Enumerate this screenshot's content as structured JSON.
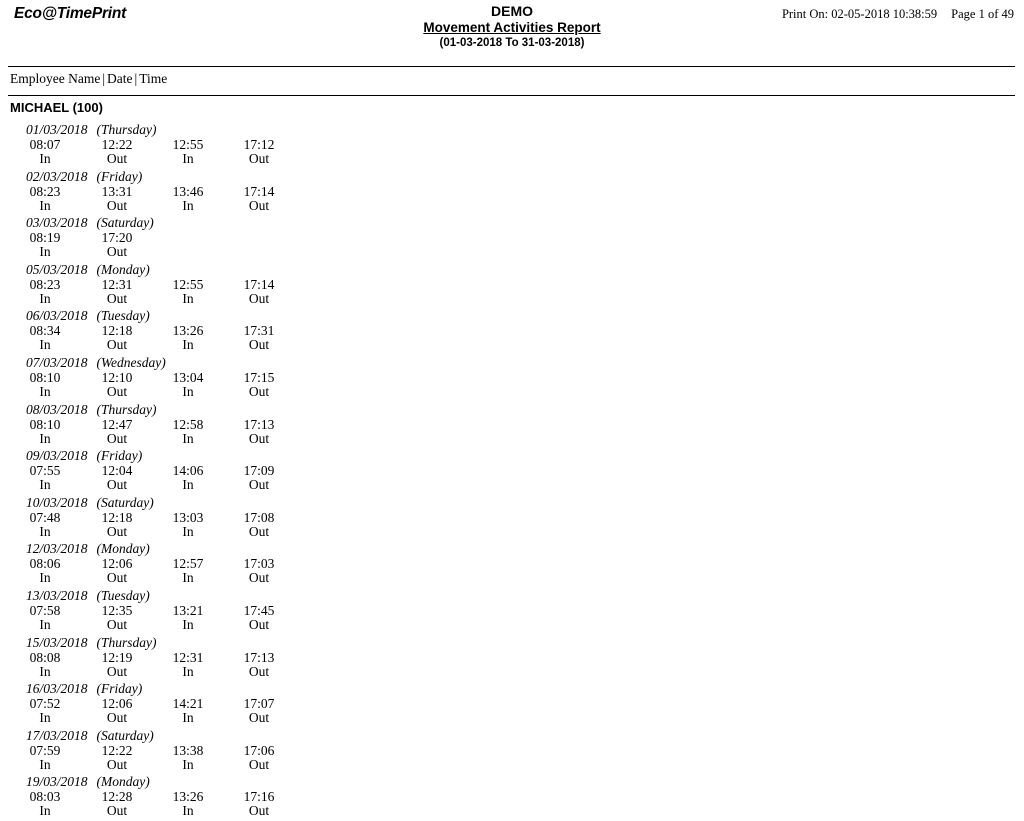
{
  "header": {
    "brand": "Eco@TimePrint",
    "company": "DEMO",
    "report_title": "Movement Activities Report",
    "date_range": "(01-03-2018 To 31-03-2018)",
    "print_on": "Print On: 02-05-2018 10:38:59",
    "page_indicator": "Page 1 of 49"
  },
  "columns": {
    "employee_name": "Employee Name",
    "separator": "|",
    "date": "Date",
    "time": "Time"
  },
  "employee": {
    "name": "MICHAEL (100)"
  },
  "days": [
    {
      "date": "01/03/2018",
      "day_of_week": "(Thursday)",
      "punches": [
        {
          "time": "08:07",
          "type": "In"
        },
        {
          "time": "12:22",
          "type": "Out"
        },
        {
          "time": "12:55",
          "type": "In"
        },
        {
          "time": "17:12",
          "type": "Out"
        }
      ]
    },
    {
      "date": "02/03/2018",
      "day_of_week": "(Friday)",
      "punches": [
        {
          "time": "08:23",
          "type": "In"
        },
        {
          "time": "13:31",
          "type": "Out"
        },
        {
          "time": "13:46",
          "type": "In"
        },
        {
          "time": "17:14",
          "type": "Out"
        }
      ]
    },
    {
      "date": "03/03/2018",
      "day_of_week": "(Saturday)",
      "punches": [
        {
          "time": "08:19",
          "type": "In"
        },
        {
          "time": "17:20",
          "type": "Out"
        }
      ]
    },
    {
      "date": "05/03/2018",
      "day_of_week": "(Monday)",
      "punches": [
        {
          "time": "08:23",
          "type": "In"
        },
        {
          "time": "12:31",
          "type": "Out"
        },
        {
          "time": "12:55",
          "type": "In"
        },
        {
          "time": "17:14",
          "type": "Out"
        }
      ]
    },
    {
      "date": "06/03/2018",
      "day_of_week": "(Tuesday)",
      "punches": [
        {
          "time": "08:34",
          "type": "In"
        },
        {
          "time": "12:18",
          "type": "Out"
        },
        {
          "time": "13:26",
          "type": "In"
        },
        {
          "time": "17:31",
          "type": "Out"
        }
      ]
    },
    {
      "date": "07/03/2018",
      "day_of_week": "(Wednesday)",
      "punches": [
        {
          "time": "08:10",
          "type": "In"
        },
        {
          "time": "12:10",
          "type": "Out"
        },
        {
          "time": "13:04",
          "type": "In"
        },
        {
          "time": "17:15",
          "type": "Out"
        }
      ]
    },
    {
      "date": "08/03/2018",
      "day_of_week": "(Thursday)",
      "punches": [
        {
          "time": "08:10",
          "type": "In"
        },
        {
          "time": "12:47",
          "type": "Out"
        },
        {
          "time": "12:58",
          "type": "In"
        },
        {
          "time": "17:13",
          "type": "Out"
        }
      ]
    },
    {
      "date": "09/03/2018",
      "day_of_week": "(Friday)",
      "punches": [
        {
          "time": "07:55",
          "type": "In"
        },
        {
          "time": "12:04",
          "type": "Out"
        },
        {
          "time": "14:06",
          "type": "In"
        },
        {
          "time": "17:09",
          "type": "Out"
        }
      ]
    },
    {
      "date": "10/03/2018",
      "day_of_week": "(Saturday)",
      "punches": [
        {
          "time": "07:48",
          "type": "In"
        },
        {
          "time": "12:18",
          "type": "Out"
        },
        {
          "time": "13:03",
          "type": "In"
        },
        {
          "time": "17:08",
          "type": "Out"
        }
      ]
    },
    {
      "date": "12/03/2018",
      "day_of_week": "(Monday)",
      "punches": [
        {
          "time": "08:06",
          "type": "In"
        },
        {
          "time": "12:06",
          "type": "Out"
        },
        {
          "time": "12:57",
          "type": "In"
        },
        {
          "time": "17:03",
          "type": "Out"
        }
      ]
    },
    {
      "date": "13/03/2018",
      "day_of_week": "(Tuesday)",
      "punches": [
        {
          "time": "07:58",
          "type": "In"
        },
        {
          "time": "12:35",
          "type": "Out"
        },
        {
          "time": "13:21",
          "type": "In"
        },
        {
          "time": "17:45",
          "type": "Out"
        }
      ]
    },
    {
      "date": "15/03/2018",
      "day_of_week": "(Thursday)",
      "punches": [
        {
          "time": "08:08",
          "type": "In"
        },
        {
          "time": "12:19",
          "type": "Out"
        },
        {
          "time": "12:31",
          "type": "In"
        },
        {
          "time": "17:13",
          "type": "Out"
        }
      ]
    },
    {
      "date": "16/03/2018",
      "day_of_week": "(Friday)",
      "punches": [
        {
          "time": "07:52",
          "type": "In"
        },
        {
          "time": "12:06",
          "type": "Out"
        },
        {
          "time": "14:21",
          "type": "In"
        },
        {
          "time": "17:07",
          "type": "Out"
        }
      ]
    },
    {
      "date": "17/03/2018",
      "day_of_week": "(Saturday)",
      "punches": [
        {
          "time": "07:59",
          "type": "In"
        },
        {
          "time": "12:22",
          "type": "Out"
        },
        {
          "time": "13:38",
          "type": "In"
        },
        {
          "time": "17:06",
          "type": "Out"
        }
      ]
    },
    {
      "date": "19/03/2018",
      "day_of_week": "(Monday)",
      "punches": [
        {
          "time": "08:03",
          "type": "In"
        },
        {
          "time": "12:28",
          "type": "Out"
        },
        {
          "time": "13:26",
          "type": "In"
        },
        {
          "time": "17:16",
          "type": "Out"
        }
      ]
    }
  ]
}
